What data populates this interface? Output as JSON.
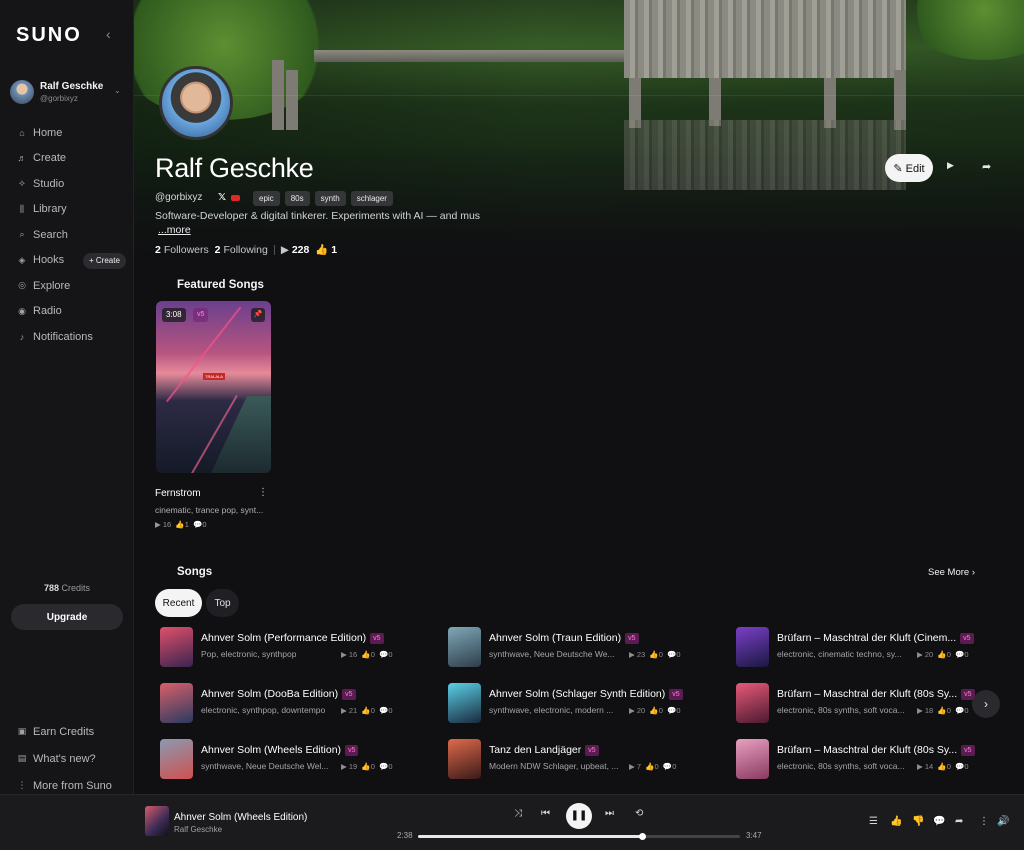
{
  "app": {
    "logo": "SUNO",
    "collapse_icon": "chevron-left-icon"
  },
  "user": {
    "name": "Ralf Geschke",
    "handle": "@gorbixyz"
  },
  "nav": [
    {
      "label": "Home",
      "icon": "⌂"
    },
    {
      "label": "Create",
      "icon": "♬"
    },
    {
      "label": "Studio",
      "icon": "⟡"
    },
    {
      "label": "Library",
      "icon": "⫼"
    },
    {
      "label": "Search",
      "icon": "⌕"
    },
    {
      "label": "Hooks",
      "icon": "◈"
    },
    {
      "label": "Explore",
      "icon": "◎"
    },
    {
      "label": "Radio",
      "icon": "◉"
    },
    {
      "label": "Notifications",
      "icon": "♪"
    }
  ],
  "hooks_create": "+ Create",
  "credits": {
    "amount": "788",
    "label": "Credits"
  },
  "upgrade_label": "Upgrade",
  "bottom_nav": [
    {
      "label": "Earn Credits",
      "icon": "▣"
    },
    {
      "label": "What's new?",
      "icon": "▤"
    },
    {
      "label": "More from Suno",
      "icon": "⋮"
    }
  ],
  "social": [
    "𝕏",
    "◎",
    "♪",
    "◫"
  ],
  "profile": {
    "name": "Ralf Geschke",
    "handle": "@gorbixyz",
    "tags": [
      "epic",
      "80s",
      "synth",
      "schlager"
    ],
    "bio": "Software-Developer & digital tinkerer. Experiments with AI — and mus",
    "more": "...more",
    "followers_count": "2",
    "followers_label": "Followers",
    "following_count": "2",
    "following_label": "Following",
    "plays": "228",
    "likes": "1",
    "edit_label": "Edit"
  },
  "featured": {
    "title": "Featured Songs",
    "song": {
      "duration": "3:08",
      "version": "v5",
      "title": "Fernstrom",
      "genre": "cinematic, trance pop, synt...",
      "plays": "16",
      "likes": "1",
      "comments": "0",
      "sign_text": "TRALALA"
    }
  },
  "songs": {
    "title": "Songs",
    "see_more": "See More",
    "tabs": [
      "Recent",
      "Top"
    ],
    "items": [
      {
        "title": "Ahnver Solm (Performance Edition)",
        "version": "v5",
        "genre": "Pop, electronic, synthpop",
        "plays": "16",
        "likes": "0",
        "comments": "0",
        "colors": [
          "#e0506a",
          "#3a2450"
        ]
      },
      {
        "title": "Ahnver Solm (Traun Edition)",
        "version": "v5",
        "genre": "synthwave, Neue Deutsche We...",
        "plays": "23",
        "likes": "0",
        "comments": "0",
        "colors": [
          "#7fa8b8",
          "#2e3e4a"
        ]
      },
      {
        "title": "Brüfarn – Maschtral der Kluft (Cinem...",
        "version": "v5",
        "genre": "electronic, cinematic techno, sy...",
        "plays": "20",
        "likes": "0",
        "comments": "0",
        "colors": [
          "#7a40c8",
          "#1a1840"
        ]
      },
      {
        "title": "Ahnver Solm (DooBa Edition)",
        "version": "v5",
        "genre": "electronic, synthpop, downtempo",
        "plays": "21",
        "likes": "0",
        "comments": "0",
        "colors": [
          "#d9606a",
          "#2a3a60"
        ]
      },
      {
        "title": "Ahnver Solm (Schlager Synth Edition)",
        "version": "v5",
        "genre": "synthwave, electronic, modern ...",
        "plays": "20",
        "likes": "0",
        "comments": "0",
        "colors": [
          "#5ad0e8",
          "#1a2a3e"
        ]
      },
      {
        "title": "Brüfarn – Maschtral der Kluft (80s Sy...",
        "version": "v5",
        "genre": "electronic, 80s synths, soft voca...",
        "plays": "18",
        "likes": "0",
        "comments": "0",
        "colors": [
          "#e85a78",
          "#4a1a30"
        ]
      },
      {
        "title": "Ahnver Solm (Wheels Edition)",
        "version": "v5",
        "genre": "synthwave, Neue Deutsche Wel...",
        "plays": "19",
        "likes": "0",
        "comments": "0",
        "colors": [
          "#8a9ab0",
          "#d05050"
        ]
      },
      {
        "title": "Tanz den Landjäger",
        "version": "v5",
        "genre": "Modern NDW Schlager, upbeat, ...",
        "plays": "7",
        "likes": "0",
        "comments": "0",
        "colors": [
          "#e06a4a",
          "#3a1a1a"
        ]
      },
      {
        "title": "Brüfarn – Maschtral der Kluft (80s Sy...",
        "version": "v5",
        "genre": "electronic, 80s synths, soft voca...",
        "plays": "14",
        "likes": "0",
        "comments": "0",
        "colors": [
          "#e8a0c0",
          "#8a3a60"
        ]
      }
    ]
  },
  "player": {
    "title": "Ahnver Solm (Wheels Edition)",
    "artist": "Ralf Geschke",
    "elapsed": "2:38",
    "total": "3:47",
    "progress": 0.696
  }
}
